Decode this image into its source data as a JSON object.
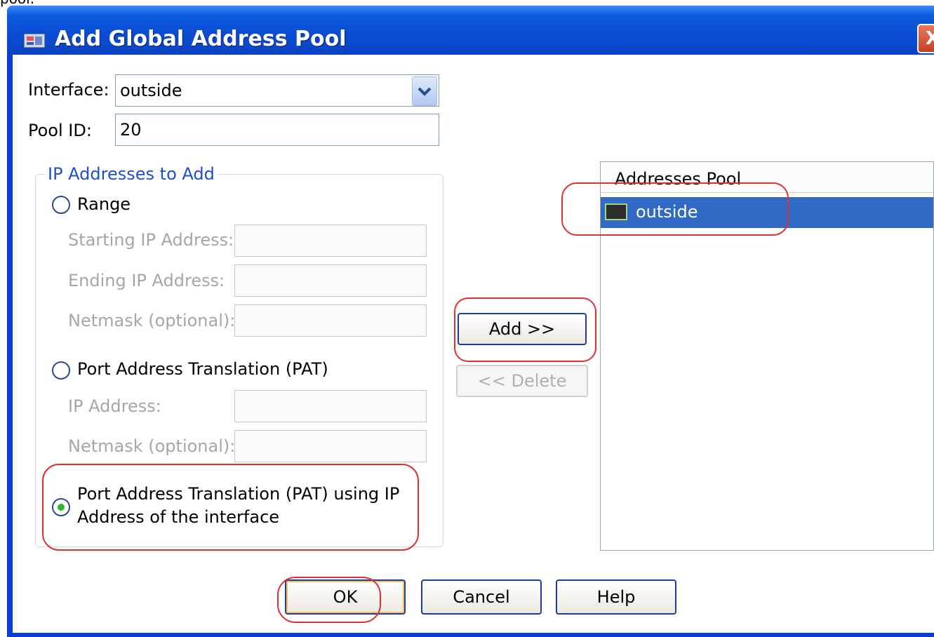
{
  "top_fragment": "pool.",
  "window": {
    "title": "Add Global Address Pool",
    "close_glyph": "X"
  },
  "form": {
    "interface_label": "Interface:",
    "interface_value": "outside",
    "pool_id_label": "Pool ID:",
    "pool_id_value": "20"
  },
  "group": {
    "title": "IP Addresses to Add",
    "range_label": "Range",
    "starting_ip_label": "Starting IP Address:",
    "ending_ip_label": "Ending  IP Address:",
    "netmask_label": "Netmask (optional):",
    "pat_label": "Port Address Translation (PAT)",
    "pat_ip_label": "IP Address:",
    "pat_netmask_label": "Netmask (optional):",
    "pat_iface_line1": "Port Address Translation (PAT) using IP",
    "pat_iface_line2": "Address of the interface",
    "selected_option": "pat_interface"
  },
  "buttons": {
    "add": "Add >>",
    "delete": "<< Delete",
    "ok": "OK",
    "cancel": "Cancel",
    "help": "Help"
  },
  "pool_list": {
    "header": "Addresses Pool",
    "items": [
      {
        "label": "outside",
        "icon": "interface-icon",
        "selected": true
      }
    ]
  },
  "colors": {
    "accent": "#0a4bd3",
    "selection": "#316ac5",
    "annotation": "#e03030"
  }
}
